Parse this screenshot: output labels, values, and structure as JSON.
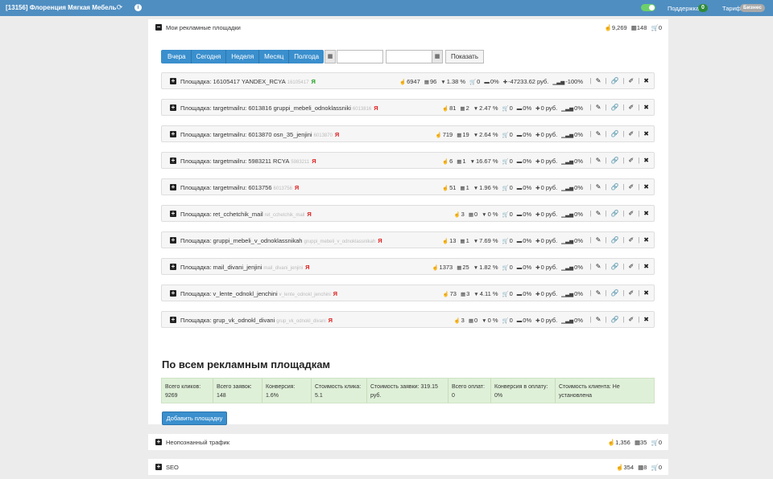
{
  "header": {
    "title": "[13156] Флоренция Мягкая Мебель",
    "support_label": "Поддержка",
    "support_count": "0",
    "tariff_label": "Тариф:",
    "tariff_value": "Бизнес"
  },
  "panels": {
    "ads": {
      "title": "Мои рекламные площадки",
      "clicks": "9,269",
      "leads": "148",
      "payments": "0"
    },
    "unknown": {
      "title": "Неопознанный трафик",
      "clicks": "1,356",
      "leads": "35",
      "payments": "0"
    },
    "seo": {
      "title": "SEO",
      "clicks": "354",
      "leads": "8",
      "payments": "0"
    }
  },
  "filters": {
    "periods": [
      "Вчера",
      "Сегодня",
      "Неделя",
      "Месяц",
      "Полгода"
    ],
    "show_button": "Показать"
  },
  "platforms": [
    {
      "prefix": "Площадка:",
      "name": "16105417 YANDEX_RCYA",
      "sub": "16105417",
      "ya": "Я",
      "ya_color": "#22a022",
      "clicks": "6947",
      "leads": "96",
      "conv": "1.38 %",
      "orders": "0",
      "pay_conv": "0%",
      "profit": "-47233.62 руб.",
      "roi": "-100%"
    },
    {
      "prefix": "Площадка:",
      "name": "targetmailru: 6013816 gruppi_mebeli_odnoklassniki",
      "sub": "6013816",
      "ya": "Я",
      "ya_color": "#e02020",
      "clicks": "81",
      "leads": "2",
      "conv": "2.47 %",
      "orders": "0",
      "pay_conv": "0%",
      "profit": "0 руб.",
      "roi": "0%"
    },
    {
      "prefix": "Площадка:",
      "name": "targetmailru: 6013870 osn_35_jenjini",
      "sub": "6013870",
      "ya": "Я",
      "ya_color": "#e02020",
      "clicks": "719",
      "leads": "19",
      "conv": "2.64 %",
      "orders": "0",
      "pay_conv": "0%",
      "profit": "0 руб.",
      "roi": "0%"
    },
    {
      "prefix": "Площадка:",
      "name": "targetmailru: 5983211 RCYA",
      "sub": "5983211",
      "ya": "Я",
      "ya_color": "#e02020",
      "clicks": "6",
      "leads": "1",
      "conv": "16.67 %",
      "orders": "0",
      "pay_conv": "0%",
      "profit": "0 руб.",
      "roi": "0%"
    },
    {
      "prefix": "Площадка:",
      "name": "targetmailru: 6013756",
      "sub": "6013756",
      "ya": "Я",
      "ya_color": "#e02020",
      "clicks": "51",
      "leads": "1",
      "conv": "1.96 %",
      "orders": "0",
      "pay_conv": "0%",
      "profit": "0 руб.",
      "roi": "0%"
    },
    {
      "prefix": "Площадка:",
      "name": "ret_cchetchik_mail",
      "sub": "ret_cchetchik_mail",
      "ya": "Я",
      "ya_color": "#e02020",
      "clicks": "3",
      "leads": "0",
      "conv": "0 %",
      "orders": "0",
      "pay_conv": "0%",
      "profit": "0 руб.",
      "roi": "0%"
    },
    {
      "prefix": "Площадка:",
      "name": "gruppi_mebeli_v_odnoklassnikah",
      "sub": "gruppi_mebeli_v_odnoklassnikah",
      "ya": "Я",
      "ya_color": "#e02020",
      "clicks": "13",
      "leads": "1",
      "conv": "7.69 %",
      "orders": "0",
      "pay_conv": "0%",
      "profit": "0 руб.",
      "roi": "0%"
    },
    {
      "prefix": "Площадка:",
      "name": "mail_divani_jenjini",
      "sub": "mail_divani_jenjini",
      "ya": "Я",
      "ya_color": "#e02020",
      "clicks": "1373",
      "leads": "25",
      "conv": "1.82 %",
      "orders": "0",
      "pay_conv": "0%",
      "profit": "0 руб.",
      "roi": "0%"
    },
    {
      "prefix": "Площадка:",
      "name": "v_lente_odnokl_jenchini",
      "sub": "v_lente_odnokl_jenchini",
      "ya": "Я",
      "ya_color": "#e02020",
      "clicks": "73",
      "leads": "3",
      "conv": "4.11 %",
      "orders": "0",
      "pay_conv": "0%",
      "profit": "0 руб.",
      "roi": "0%"
    },
    {
      "prefix": "Площадка:",
      "name": "grup_vk_odnokl_divani",
      "sub": "grup_vk_odnokl_divani",
      "ya": "Я",
      "ya_color": "#e02020",
      "clicks": "3",
      "leads": "0",
      "conv": "0 %",
      "orders": "0",
      "pay_conv": "0%",
      "profit": "0 руб.",
      "roi": "0%"
    }
  ],
  "summary": {
    "title": "По всем рекламным площадкам",
    "cells": [
      {
        "label": "Всего кликов:",
        "value": "9269"
      },
      {
        "label": "Всего заявок:",
        "value": "148"
      },
      {
        "label": "Конверсия:",
        "value": "1.6%"
      },
      {
        "label": "Стоимость клика:",
        "value": "5.1"
      },
      {
        "label": "Стоимость заявки: 319.15",
        "value": "руб."
      },
      {
        "label": "Всего оплат:",
        "value": "0"
      },
      {
        "label": "Конверсия в оплату:",
        "value": "0%"
      },
      {
        "label": "Стоимость клиента: Не",
        "value": "установлена"
      }
    ],
    "add_button": "Добавить площадку"
  },
  "colors": {
    "header_bg": "#4f8ec1",
    "accent": "#3a8fcd",
    "summary_bg": "#dff0d8"
  }
}
